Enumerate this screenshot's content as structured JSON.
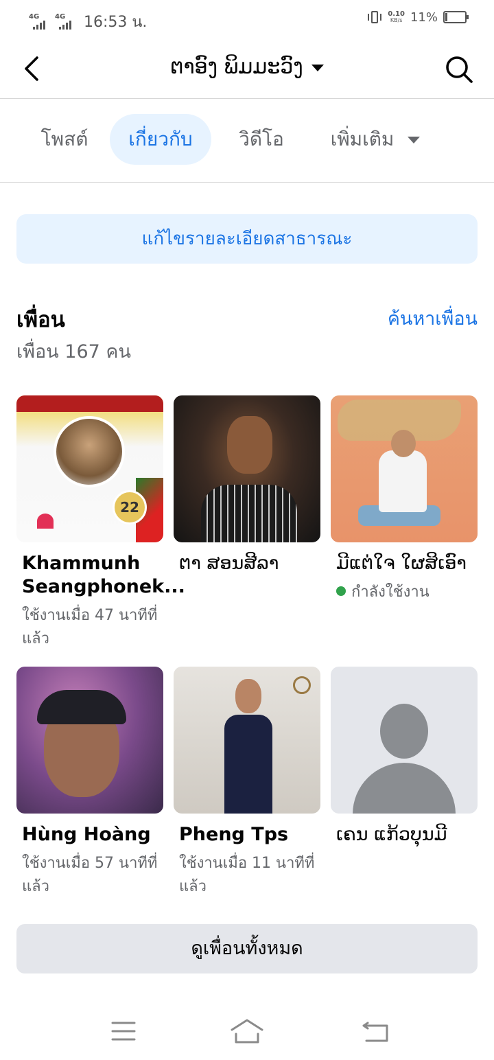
{
  "status_bar": {
    "network_1": "4G",
    "network_2": "4G",
    "time": "16:53 น.",
    "speed_value": "0.10",
    "speed_unit": "KB/s",
    "battery_percent": "11%",
    "battery_level": 0.11
  },
  "header": {
    "title": "ຕາອົງ ພິມມະວົງ",
    "back_icon": "chevron-left-icon",
    "search_icon": "search-icon"
  },
  "tabs": [
    {
      "label": "โพสต์",
      "active": false
    },
    {
      "label": "เกี่ยวกับ",
      "active": true
    },
    {
      "label": "วิดีโอ",
      "active": false
    },
    {
      "label": "เพิ่มเติม",
      "active": false
    }
  ],
  "edit_public_details": "แก้ไขรายละเอียดสาธารณะ",
  "friends": {
    "title": "เพื่อน",
    "find_friends": "ค้นหาเพื่อน",
    "count_text": "เพื่อน 167 คน",
    "items": [
      {
        "name": "Khammunh Seangphonek...",
        "status": "ใช้งานเมื่อ 47 นาทีที่แล้ว",
        "badge": "22"
      },
      {
        "name": "ຕາ ສອນສີລາ",
        "status": ""
      },
      {
        "name": "ມີແຕ່ໃຈ ໃຜສິເອົາ",
        "status": "กำลังใช้งาน"
      },
      {
        "name": "Hùng Hoàng",
        "status": "ใช้งานเมื่อ 57 นาทีที่แล้ว"
      },
      {
        "name": "Pheng Tps",
        "status": "ใช้งานเมื่อ 11 นาทีที่แล้ว"
      },
      {
        "name": "ເຄນ ແກ້ວບຸນມີ",
        "status": ""
      }
    ],
    "see_all": "ดูเพื่อนทั้งหมด"
  },
  "nav": {
    "menu_icon": "menu-icon",
    "home_icon": "home-icon",
    "back_icon": "back-arrow-icon"
  },
  "colors": {
    "accent": "#1b74e4",
    "accent_bg": "#e7f3ff",
    "online": "#31a24c",
    "secondary_text": "#65676b"
  }
}
